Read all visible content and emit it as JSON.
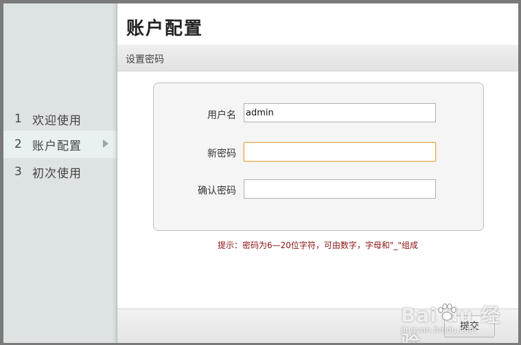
{
  "sidebar": {
    "steps": [
      {
        "num": "1",
        "label": "欢迎使用"
      },
      {
        "num": "2",
        "label": "账户配置"
      },
      {
        "num": "3",
        "label": "初次使用"
      }
    ]
  },
  "main": {
    "title": "账户配置",
    "section_title": "设置密码",
    "form": {
      "username_label": "用户名",
      "username_value": "admin",
      "new_password_label": "新密码",
      "new_password_value": "",
      "confirm_password_label": "确认密码",
      "confirm_password_value": ""
    },
    "hint": "提示：密码为6—20位字符，可由数字，字母和\"_\"组成",
    "submit_label": "提交"
  },
  "watermark": {
    "main": "Bai du 经验",
    "sub": "jingyan.baidu.com"
  }
}
